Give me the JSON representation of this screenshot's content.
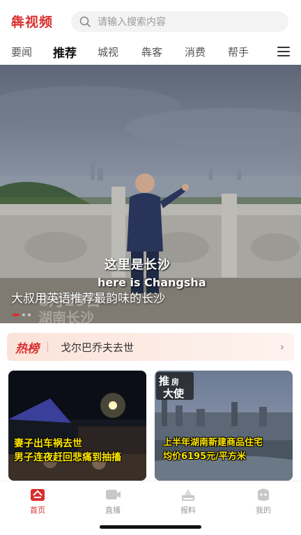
{
  "header": {
    "logo": "犇视频",
    "search_placeholder": "请输入搜索内容"
  },
  "tabs": [
    {
      "label": "要闻"
    },
    {
      "label": "推荐"
    },
    {
      "label": "城视"
    },
    {
      "label": "犇客"
    },
    {
      "label": "消费"
    },
    {
      "label": "帮手"
    }
  ],
  "hero": {
    "overlay_cn": "这里是长沙",
    "overlay_en": "here is Changsha",
    "title": "大叔用英语推荐最韵味的长沙"
  },
  "hot": {
    "label": "热榜",
    "text": "戈尔巴乔夫去世",
    "arrow": "›"
  },
  "cards": {
    "left": {
      "line1": "妻子出车祸去世",
      "line2": "男子连夜赶回悲痛到抽搐"
    },
    "right": {
      "line1": "上半年湖南新建商品住宅",
      "line2": "均价6195元/平方米",
      "stamp": "推房大使"
    }
  },
  "nav": [
    {
      "label": "首页",
      "icon": "home-icon"
    },
    {
      "label": "直播",
      "icon": "live-icon"
    },
    {
      "label": "报料",
      "icon": "report-icon"
    },
    {
      "label": "我的",
      "icon": "profile-icon"
    }
  ],
  "colors": {
    "accent": "#d8302e",
    "hot_bg": "#fbe3d9",
    "caption": "#ffe600"
  }
}
